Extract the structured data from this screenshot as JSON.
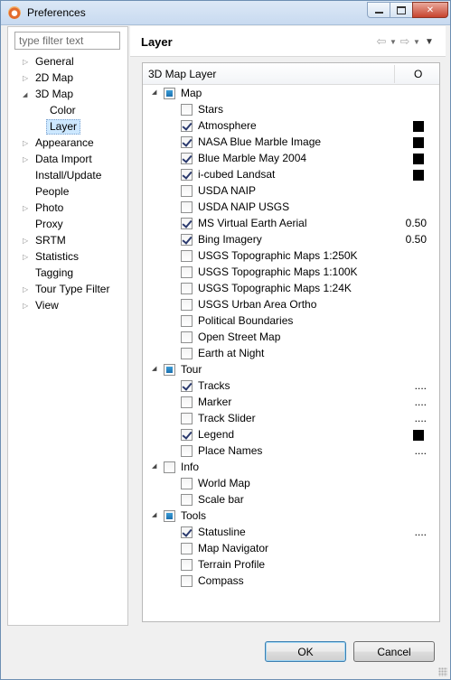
{
  "window": {
    "title": "Preferences"
  },
  "filter": {
    "placeholder": "type filter text"
  },
  "tree": [
    {
      "label": "General",
      "arrow": "collapsed",
      "indent": 0
    },
    {
      "label": "2D Map",
      "arrow": "collapsed",
      "indent": 0
    },
    {
      "label": "3D Map",
      "arrow": "expanded",
      "indent": 0
    },
    {
      "label": "Color",
      "arrow": "none",
      "indent": 1
    },
    {
      "label": "Layer",
      "arrow": "none",
      "indent": 1,
      "selected": true
    },
    {
      "label": "Appearance",
      "arrow": "collapsed",
      "indent": 0
    },
    {
      "label": "Data Import",
      "arrow": "collapsed",
      "indent": 0
    },
    {
      "label": "Install/Update",
      "arrow": "none",
      "indent": 0
    },
    {
      "label": "People",
      "arrow": "none",
      "indent": 0
    },
    {
      "label": "Photo",
      "arrow": "collapsed",
      "indent": 0
    },
    {
      "label": "Proxy",
      "arrow": "none",
      "indent": 0
    },
    {
      "label": "SRTM",
      "arrow": "collapsed",
      "indent": 0
    },
    {
      "label": "Statistics",
      "arrow": "collapsed",
      "indent": 0
    },
    {
      "label": "Tagging",
      "arrow": "none",
      "indent": 0
    },
    {
      "label": "Tour Type Filter",
      "arrow": "collapsed",
      "indent": 0
    },
    {
      "label": "View",
      "arrow": "collapsed",
      "indent": 0
    }
  ],
  "page": {
    "title": "Layer"
  },
  "table": {
    "col_layer": "3D Map Layer",
    "col_opacity": "O"
  },
  "layers": [
    {
      "label": "Map",
      "group": true,
      "state": "partial"
    },
    {
      "label": "Stars",
      "state": "unchecked",
      "value": ""
    },
    {
      "label": "Atmosphere",
      "state": "checked",
      "value": "swatch"
    },
    {
      "label": "NASA Blue Marble Image",
      "state": "checked",
      "value": "swatch"
    },
    {
      "label": "Blue Marble May 2004",
      "state": "checked",
      "value": "swatch"
    },
    {
      "label": "i-cubed Landsat",
      "state": "checked",
      "value": "swatch"
    },
    {
      "label": "USDA NAIP",
      "state": "unchecked",
      "value": ""
    },
    {
      "label": "USDA NAIP USGS",
      "state": "unchecked",
      "value": ""
    },
    {
      "label": "MS Virtual Earth Aerial",
      "state": "checked",
      "value": "0.50"
    },
    {
      "label": "Bing Imagery",
      "state": "checked",
      "value": "0.50"
    },
    {
      "label": "USGS Topographic Maps 1:250K",
      "state": "unchecked",
      "value": ""
    },
    {
      "label": "USGS Topographic Maps 1:100K",
      "state": "unchecked",
      "value": ""
    },
    {
      "label": "USGS Topographic Maps 1:24K",
      "state": "unchecked",
      "value": ""
    },
    {
      "label": "USGS Urban Area Ortho",
      "state": "unchecked",
      "value": ""
    },
    {
      "label": "Political Boundaries",
      "state": "unchecked",
      "value": ""
    },
    {
      "label": "Open Street Map",
      "state": "unchecked",
      "value": ""
    },
    {
      "label": "Earth at Night",
      "state": "unchecked",
      "value": ""
    },
    {
      "label": "Tour",
      "group": true,
      "state": "partial"
    },
    {
      "label": "Tracks",
      "state": "checked",
      "value": "...."
    },
    {
      "label": "Marker",
      "state": "unchecked",
      "value": "...."
    },
    {
      "label": "Track Slider",
      "state": "unchecked",
      "value": "...."
    },
    {
      "label": "Legend",
      "state": "checked",
      "value": "swatch"
    },
    {
      "label": "Place Names",
      "state": "unchecked",
      "value": "...."
    },
    {
      "label": "Info",
      "group": true,
      "state": "unchecked"
    },
    {
      "label": "World Map",
      "state": "unchecked",
      "value": ""
    },
    {
      "label": "Scale bar",
      "state": "unchecked",
      "value": ""
    },
    {
      "label": "Tools",
      "group": true,
      "state": "partial"
    },
    {
      "label": "Statusline",
      "state": "checked",
      "value": "...."
    },
    {
      "label": "Map Navigator",
      "state": "unchecked",
      "value": ""
    },
    {
      "label": "Terrain Profile",
      "state": "unchecked",
      "value": ""
    },
    {
      "label": "Compass",
      "state": "unchecked",
      "value": ""
    }
  ],
  "buttons": {
    "ok": "OK",
    "cancel": "Cancel"
  },
  "colors": {
    "accent": "#1b6fae",
    "selection": "#cde8ff"
  },
  "icons": [
    "back-arrow-icon",
    "forward-arrow-icon",
    "view-menu-icon"
  ]
}
